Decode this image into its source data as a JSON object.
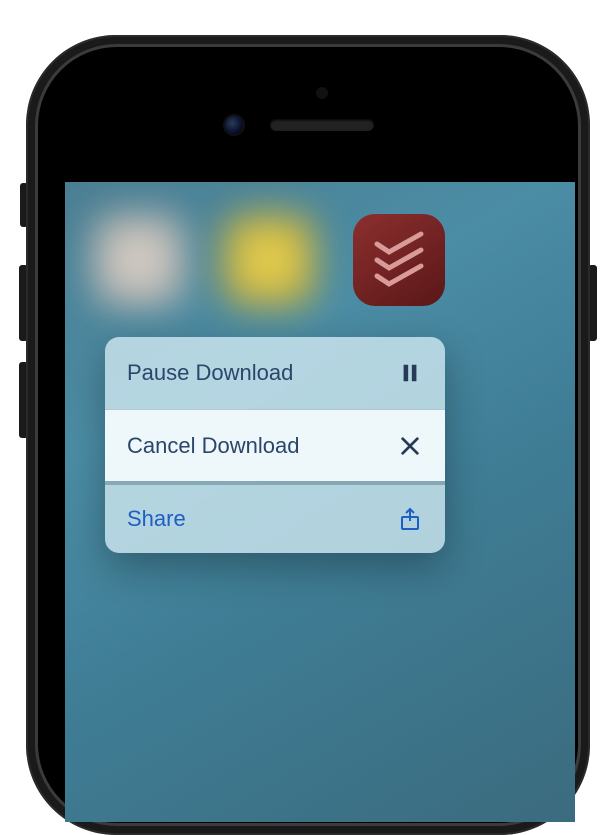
{
  "app_icon": {
    "name": "todoist"
  },
  "quick_actions": {
    "pause": {
      "label": "Pause Download"
    },
    "cancel": {
      "label": "Cancel Download"
    },
    "share": {
      "label": "Share"
    }
  }
}
